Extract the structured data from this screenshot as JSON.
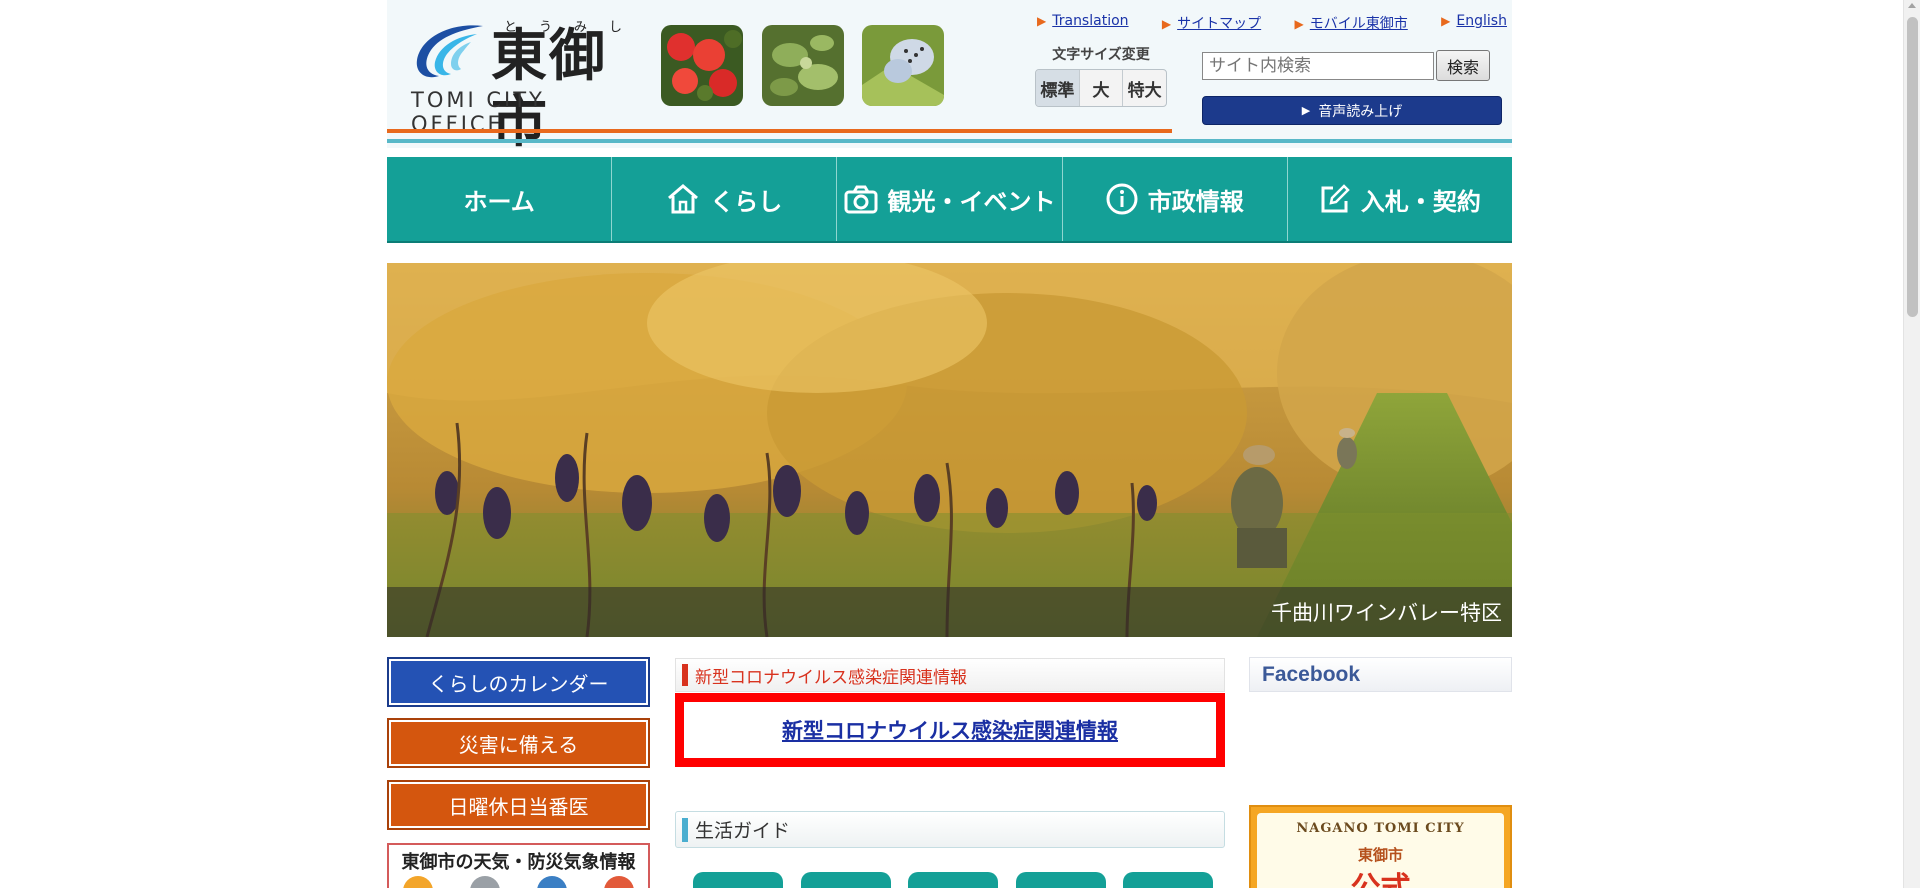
{
  "header": {
    "logo": {
      "name": "東御市",
      "ruby": [
        "と",
        "う",
        "み",
        "し"
      ],
      "sub": "TOMI CITY OFFICE"
    },
    "links": [
      {
        "label": "Translation"
      },
      {
        "label": "サイトマップ"
      },
      {
        "label": "モバイル東御市"
      },
      {
        "label": "English"
      }
    ],
    "font_size": {
      "label": "文字サイズ変更",
      "options": [
        "標準",
        "大",
        "特大"
      ],
      "selected": "標準"
    },
    "search": {
      "placeholder": "サイト内検索",
      "button_label": "検索"
    },
    "voice_button_label": "音声読み上げ"
  },
  "nav": {
    "items": [
      {
        "label": "ホーム",
        "icon": "none"
      },
      {
        "label": "くらし",
        "icon": "house-icon"
      },
      {
        "label": "観光・イベント",
        "icon": "camera-icon"
      },
      {
        "label": "市政情報",
        "icon": "info-icon"
      },
      {
        "label": "入札・契約",
        "icon": "edit-icon"
      }
    ]
  },
  "hero": {
    "caption": "千曲川ワインバレー特区"
  },
  "left": {
    "buttons": [
      {
        "label": "くらしのカレンダー",
        "color": "#2452b4"
      },
      {
        "label": "災害に備える",
        "color": "#d4560e"
      },
      {
        "label": "日曜休日当番医",
        "color": "#d4560e"
      }
    ],
    "weather_title": "東御市の天気・防災気象情報"
  },
  "center": {
    "covid": {
      "heading": "新型コロナウイルス感染症関連情報",
      "link": "新型コロナウイルス感染症関連情報"
    },
    "guide": {
      "heading": "生活ガイド"
    }
  },
  "right": {
    "facebook_heading": "Facebook",
    "banner": {
      "title": "NAGANO TOMI CITY",
      "sub": "東御市",
      "big": "公式"
    }
  },
  "colors": {
    "nav_bg": "#14a097",
    "header_orange": "#e8691d",
    "covid_red": "#ff0000",
    "link_blue": "#1a2fa3"
  }
}
